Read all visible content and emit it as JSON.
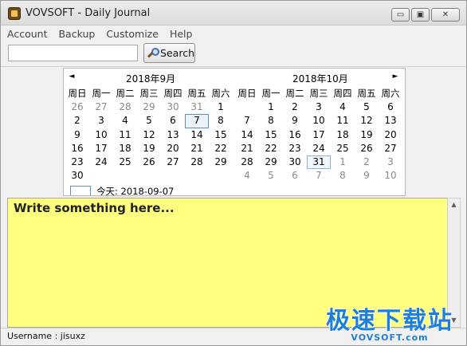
{
  "window": {
    "title": "VOVSOFT - Daily Journal",
    "minimize": "▭",
    "maximize": "▣",
    "close": "✕"
  },
  "menu": {
    "items": [
      "Account",
      "Backup",
      "Customize",
      "Help"
    ]
  },
  "toolbar": {
    "search_value": "",
    "search_label": "Search"
  },
  "calendar": {
    "prev_arrow": "◄",
    "next_arrow": "►",
    "weekdays": [
      "周日",
      "周一",
      "周二",
      "周三",
      "周四",
      "周五",
      "周六"
    ],
    "months": [
      {
        "title": "2018年9月",
        "rows": [
          [
            {
              "d": "26",
              "o": true
            },
            {
              "d": "27",
              "o": true
            },
            {
              "d": "28",
              "o": true
            },
            {
              "d": "29",
              "o": true
            },
            {
              "d": "30",
              "o": true
            },
            {
              "d": "31",
              "o": true
            },
            {
              "d": "1"
            }
          ],
          [
            {
              "d": "2"
            },
            {
              "d": "3"
            },
            {
              "d": "4"
            },
            {
              "d": "5"
            },
            {
              "d": "6"
            },
            {
              "d": "7",
              "sel": true
            },
            {
              "d": "8"
            }
          ],
          [
            {
              "d": "9"
            },
            {
              "d": "10"
            },
            {
              "d": "11"
            },
            {
              "d": "12"
            },
            {
              "d": "13"
            },
            {
              "d": "14"
            },
            {
              "d": "15"
            }
          ],
          [
            {
              "d": "16"
            },
            {
              "d": "17"
            },
            {
              "d": "18"
            },
            {
              "d": "19"
            },
            {
              "d": "20"
            },
            {
              "d": "21"
            },
            {
              "d": "22"
            }
          ],
          [
            {
              "d": "23"
            },
            {
              "d": "24"
            },
            {
              "d": "25"
            },
            {
              "d": "26"
            },
            {
              "d": "27"
            },
            {
              "d": "28"
            },
            {
              "d": "29"
            }
          ],
          [
            {
              "d": "30"
            },
            {
              "d": ""
            },
            {
              "d": ""
            },
            {
              "d": ""
            },
            {
              "d": ""
            },
            {
              "d": ""
            },
            {
              "d": ""
            }
          ]
        ]
      },
      {
        "title": "2018年10月",
        "rows": [
          [
            {
              "d": ""
            },
            {
              "d": "1"
            },
            {
              "d": "2"
            },
            {
              "d": "3"
            },
            {
              "d": "4"
            },
            {
              "d": "5"
            },
            {
              "d": "6"
            }
          ],
          [
            {
              "d": "7"
            },
            {
              "d": "8"
            },
            {
              "d": "9"
            },
            {
              "d": "10"
            },
            {
              "d": "11"
            },
            {
              "d": "12"
            },
            {
              "d": "13"
            }
          ],
          [
            {
              "d": "14"
            },
            {
              "d": "15"
            },
            {
              "d": "16"
            },
            {
              "d": "17"
            },
            {
              "d": "18"
            },
            {
              "d": "19"
            },
            {
              "d": "20"
            }
          ],
          [
            {
              "d": "21"
            },
            {
              "d": "22"
            },
            {
              "d": "23"
            },
            {
              "d": "24"
            },
            {
              "d": "25"
            },
            {
              "d": "26"
            },
            {
              "d": "27"
            }
          ],
          [
            {
              "d": "28"
            },
            {
              "d": "29"
            },
            {
              "d": "30"
            },
            {
              "d": "31",
              "mark": true
            },
            {
              "d": "1",
              "o": true
            },
            {
              "d": "2",
              "o": true
            },
            {
              "d": "3",
              "o": true
            }
          ],
          [
            {
              "d": "4",
              "o": true
            },
            {
              "d": "5",
              "o": true
            },
            {
              "d": "6",
              "o": true
            },
            {
              "d": "7",
              "o": true
            },
            {
              "d": "8",
              "o": true
            },
            {
              "d": "9",
              "o": true
            },
            {
              "d": "10",
              "o": true
            }
          ]
        ]
      }
    ],
    "today_label": "今天: 2018-09-07"
  },
  "editor": {
    "text": "Write something here..."
  },
  "scrollbar": {
    "up": "▲",
    "down": "▼"
  },
  "status": {
    "text": "Username : jisuxz"
  },
  "watermark": {
    "main": "极速下载站",
    "sub": "VOVSOFT.com"
  },
  "colors": {
    "editor_bg": "#ffff80",
    "selection_border": "#5f8fbd",
    "watermark": "#1e7fd8"
  }
}
